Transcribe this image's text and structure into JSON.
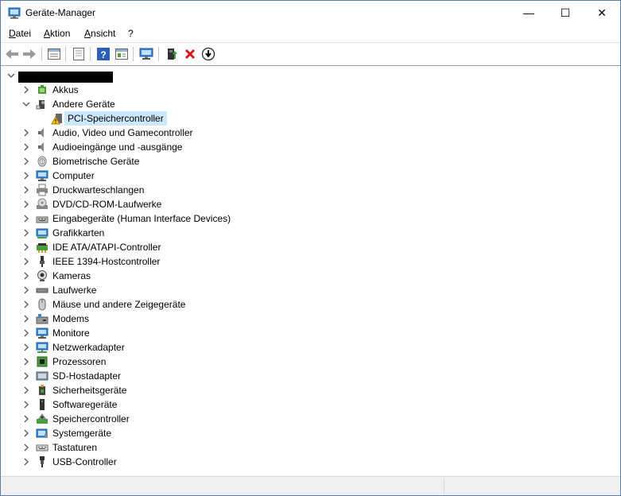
{
  "window": {
    "title": "Geräte-Manager",
    "controls": {
      "minimize": "—",
      "maximize": "☐",
      "close": "✕"
    }
  },
  "menu": [
    "Datei",
    "Aktion",
    "Ansicht",
    "?"
  ],
  "toolbar": {
    "items": [
      "back-icon",
      "forward-icon",
      "properties-list-icon",
      "properties-icon",
      "help-icon",
      "scan-view-icon",
      "monitor-icon",
      "update-driver-icon",
      "uninstall-icon",
      "disable-device-icon"
    ]
  },
  "tree": {
    "root_label_redacted": true,
    "categories": [
      {
        "label": "Akkus",
        "icon": "battery-icon",
        "expanded": false
      },
      {
        "label": "Andere Geräte",
        "icon": "other-devices-icon",
        "expanded": true,
        "children": [
          {
            "label": "PCI-Speichercontroller",
            "icon": "warning-device-icon",
            "selected": true
          }
        ]
      },
      {
        "label": "Audio, Video und Gamecontroller",
        "icon": "speaker-icon",
        "expanded": false
      },
      {
        "label": "Audioeingänge und -ausgänge",
        "icon": "speaker-icon",
        "expanded": false
      },
      {
        "label": "Biometrische Geräte",
        "icon": "fingerprint-icon",
        "expanded": false
      },
      {
        "label": "Computer",
        "icon": "computer-icon",
        "expanded": false
      },
      {
        "label": "Druckwarteschlangen",
        "icon": "printer-icon",
        "expanded": false
      },
      {
        "label": "DVD/CD-ROM-Laufwerke",
        "icon": "disc-drive-icon",
        "expanded": false
      },
      {
        "label": "Eingabegeräte (Human Interface Devices)",
        "icon": "keyboard-hid-icon",
        "expanded": false
      },
      {
        "label": "Grafikkarten",
        "icon": "display-adapter-icon",
        "expanded": false
      },
      {
        "label": "IDE ATA/ATAPI-Controller",
        "icon": "ide-controller-icon",
        "expanded": false
      },
      {
        "label": "IEEE 1394-Hostcontroller",
        "icon": "firewire-icon",
        "expanded": false
      },
      {
        "label": "Kameras",
        "icon": "camera-icon",
        "expanded": false
      },
      {
        "label": "Laufwerke",
        "icon": "disk-drive-icon",
        "expanded": false
      },
      {
        "label": "Mäuse und andere Zeigegeräte",
        "icon": "mouse-icon",
        "expanded": false
      },
      {
        "label": "Modems",
        "icon": "modem-icon",
        "expanded": false
      },
      {
        "label": "Monitore",
        "icon": "monitor-icon",
        "expanded": false
      },
      {
        "label": "Netzwerkadapter",
        "icon": "network-adapter-icon",
        "expanded": false
      },
      {
        "label": "Prozessoren",
        "icon": "processor-icon",
        "expanded": false
      },
      {
        "label": "SD-Hostadapter",
        "icon": "sd-host-icon",
        "expanded": false
      },
      {
        "label": "Sicherheitsgeräte",
        "icon": "security-device-icon",
        "expanded": false
      },
      {
        "label": "Softwaregeräte",
        "icon": "software-device-icon",
        "expanded": false
      },
      {
        "label": "Speichercontroller",
        "icon": "storage-controller-icon",
        "expanded": false
      },
      {
        "label": "Systemgeräte",
        "icon": "system-device-icon",
        "expanded": false
      },
      {
        "label": "Tastaturen",
        "icon": "keyboard-icon",
        "expanded": false
      },
      {
        "label": "USB-Controller",
        "icon": "usb-icon",
        "expanded": false
      }
    ]
  },
  "colors": {
    "selection": "#cce8ff",
    "window_border": "#5a7ea8",
    "status_bar": "#f0f0f0"
  }
}
